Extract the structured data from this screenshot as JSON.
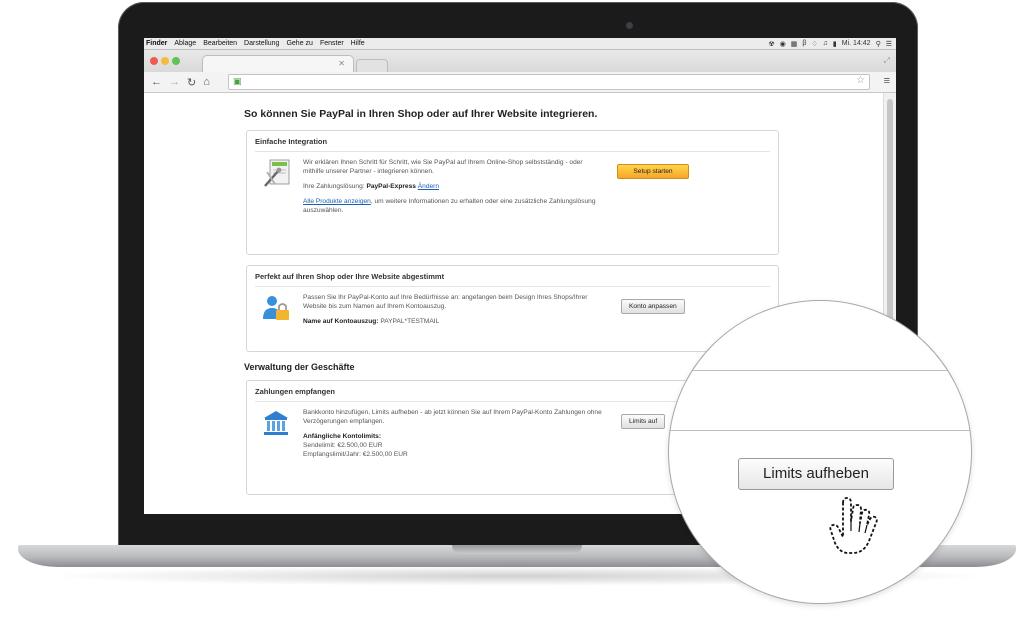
{
  "menubar": {
    "items": [
      "Finder",
      "Ablage",
      "Bearbeiten",
      "Darstellung",
      "Gehe zu",
      "Fenster",
      "Hilfe"
    ],
    "clock": "Mi. 14:42"
  },
  "page": {
    "heading": "So können Sie PayPal in Ihren Shop oder auf Ihrer Website integrieren."
  },
  "integration": {
    "title": "Einfache Integration",
    "description": "Wir erklären Ihnen Schritt für Schritt, wie Sie PayPal auf Ihrem Online-Shop selbstständig - oder mithilfe unserer Partner - integrieren können.",
    "payment_label": "Ihre Zahlungslösung:",
    "payment_value": "PayPal-Express",
    "change_link": "Ändern",
    "products_link": "Alle Produkte anzeigen",
    "products_rest": ", um weitere Informationen zu erhalten oder eine zusätzliche Zahlungslösung auszuwählen.",
    "setup_button": "Setup starten"
  },
  "customize": {
    "title": "Perfekt auf Ihren Shop oder Ihre Website abgestimmt",
    "description": "Passen Sie Ihr PayPal-Konto auf Ihre Bedürfnisse an: angefangen beim Design Ihres Shops/Ihrer Website bis zum Namen auf Ihrem Kontoauszug.",
    "statement_label": "Name auf Kontoauszug:",
    "statement_value": "PAYPAL*TESTMAIL",
    "button": "Konto anpassen"
  },
  "management": {
    "heading": "Verwaltung der Geschäfte"
  },
  "payments": {
    "title": "Zahlungen empfangen",
    "description": "Bankkonto hinzufügen, Limits aufheben - ab jetzt können Sie auf Ihrem PayPal-Konto Zahlungen ohne Verzögerungen empfangen.",
    "limits_title": "Anfängliche Kontolimits:",
    "send_limit": "Sendelimit: €2.500,00 EUR",
    "receive_limit": "Empfangslimit/Jahr: €2.500,00 EUR",
    "button_truncated": "Limits auf"
  },
  "magnifier": {
    "button": "Limits aufheben"
  }
}
